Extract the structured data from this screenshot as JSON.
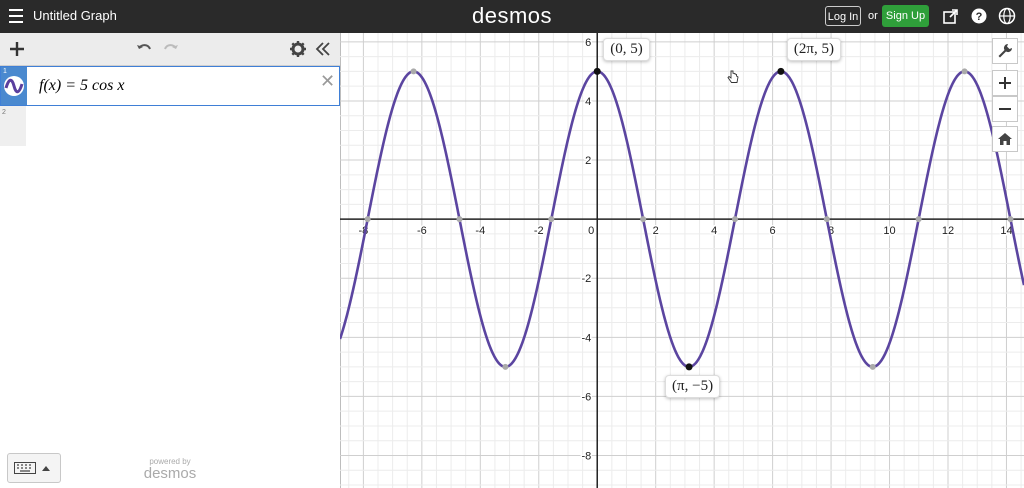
{
  "app": {
    "title": "Untitled Graph",
    "brand": "desmos",
    "login_label": "Log In",
    "or_label": "or",
    "signup_label": "Sign Up"
  },
  "expressions": [
    {
      "index": "1",
      "latex_display": "f(x) = 5 cos x",
      "color": "#5a3f9e"
    },
    {
      "index": "2",
      "latex_display": ""
    }
  ],
  "footer": {
    "powered_by": "powered by",
    "brand": "desmos"
  },
  "graph": {
    "x_range": [
      -8.8,
      14.6
    ],
    "y_range": [
      -9.1,
      6.3
    ],
    "x_ticks": [
      -8,
      -6,
      -4,
      -2,
      0,
      2,
      4,
      6,
      8,
      10,
      12,
      14
    ],
    "y_ticks": [
      -8,
      -6,
      -4,
      -2,
      2,
      4,
      6
    ],
    "curve": {
      "amplitude": 5,
      "function": "cos",
      "color": "#5b45a0"
    },
    "labeled_points": [
      {
        "x": 0,
        "y": 5,
        "label": "(0, 5)"
      },
      {
        "x": 6.283,
        "y": 5,
        "label": "(2π, 5)"
      },
      {
        "x": 3.1416,
        "y": -5,
        "label": "(π, −5)"
      }
    ]
  },
  "colors": {
    "topbar": "#2a2a2a",
    "accent_blue": "#4a89cf",
    "signup_green": "#2f9f3a",
    "curve": "#5b45a0"
  }
}
